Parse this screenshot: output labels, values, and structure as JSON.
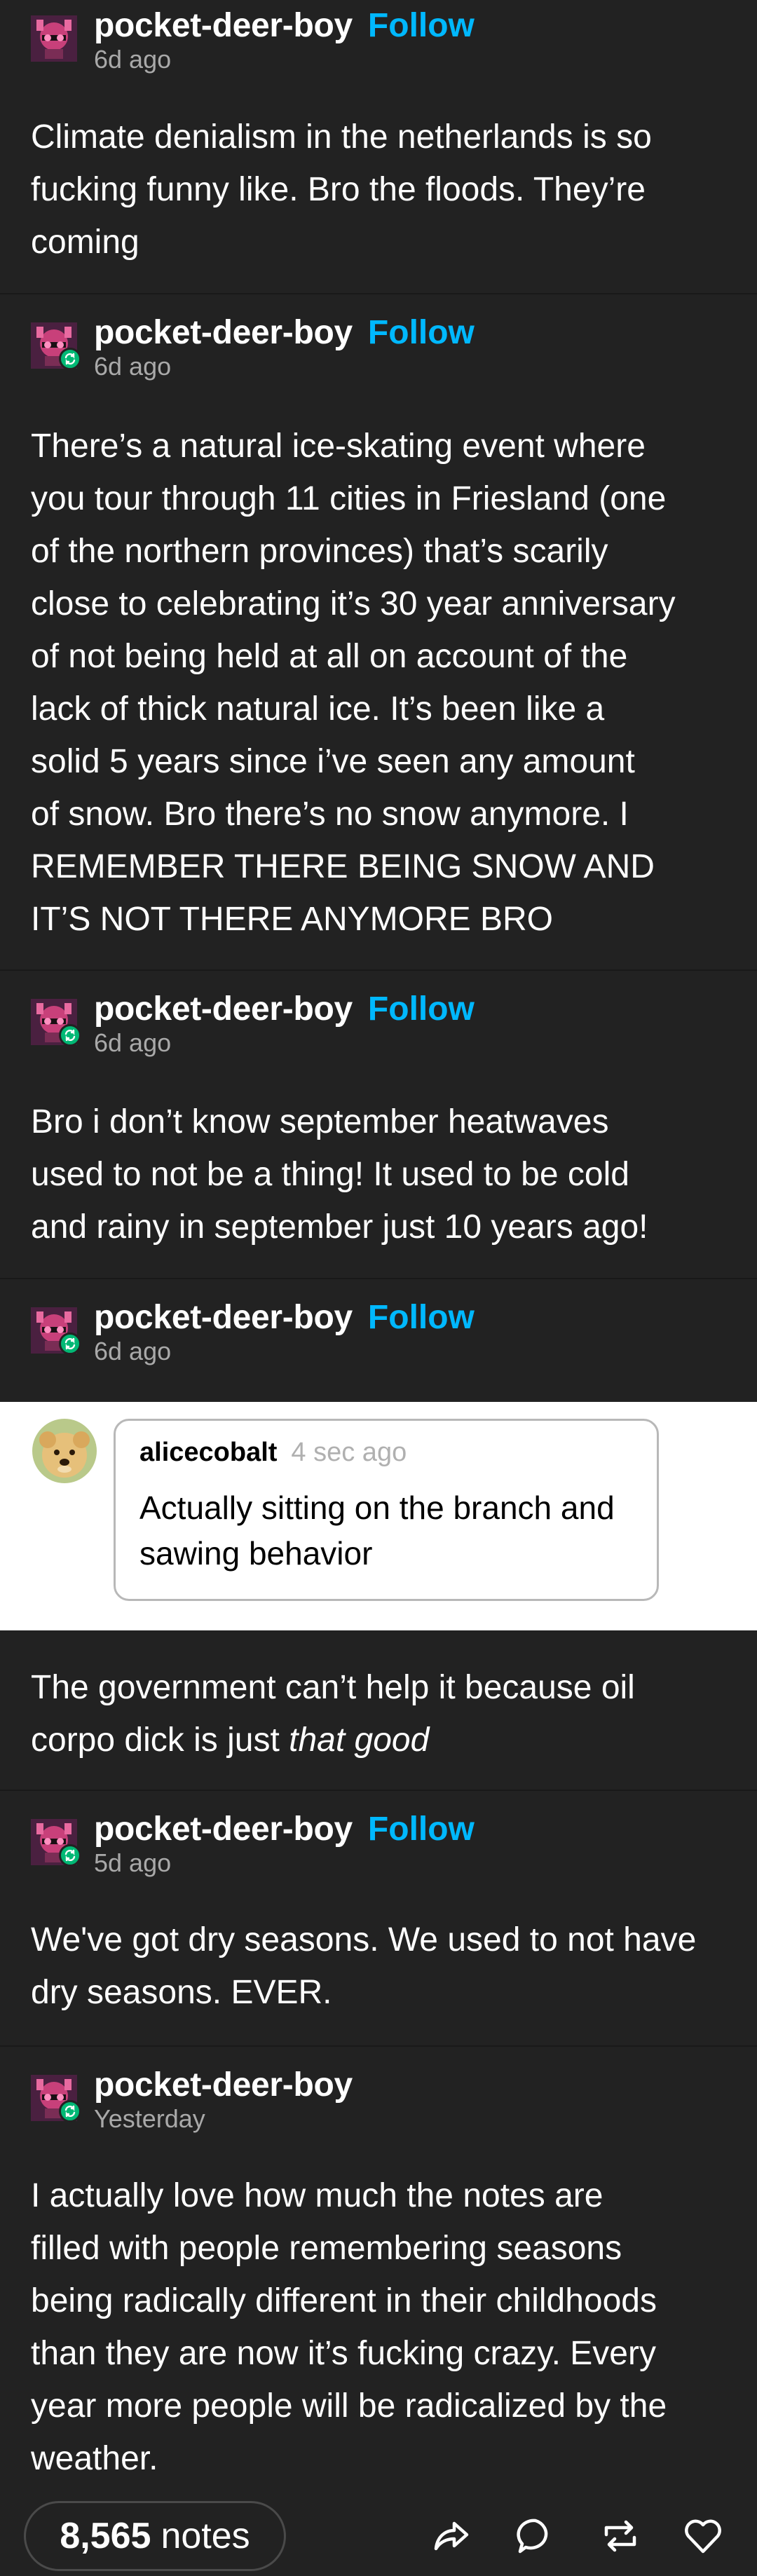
{
  "posts": [
    {
      "username": "pocket-deer-boy",
      "follow": "Follow",
      "time": "6d ago",
      "reblogged": false,
      "lines": [
        "Climate denialism in the netherlands is so",
        "fucking funny like. Bro the floods. They’re",
        "coming"
      ]
    },
    {
      "username": "pocket-deer-boy",
      "follow": "Follow",
      "time": "6d ago",
      "reblogged": true,
      "lines": [
        "There’s a natural ice-skating event where",
        "you tour through 11 cities in Friesland (one",
        "of the northern provinces) that’s scarily",
        "close to celebrating it’s 30 year anniversary",
        "of not being held at all on account of the",
        "lack of thick natural ice. It’s been like a",
        "solid 5 years since i’ve seen any amount",
        "of snow. Bro there’s no snow anymore. I",
        "REMEMBER THERE BEING SNOW AND",
        "IT’S NOT THERE ANYMORE BRO"
      ]
    },
    {
      "username": "pocket-deer-boy",
      "follow": "Follow",
      "time": "6d ago",
      "reblogged": true,
      "lines": [
        "Bro i don’t know september heatwaves",
        "used to not be a thing! It used to be cold",
        "and rainy in september just 10 years ago!"
      ]
    },
    {
      "username": "pocket-deer-boy",
      "follow": "Follow",
      "time": "6d ago",
      "reblogged": true,
      "comment": {
        "username": "alicecobalt",
        "time": "4 sec ago",
        "lines": [
          "Actually sitting on the branch and",
          "sawing behavior"
        ]
      },
      "lines": [
        "The government can’t help it because oil",
        "corpo dick is just "
      ],
      "italic_tail": "that good"
    },
    {
      "username": "pocket-deer-boy",
      "follow": "Follow",
      "time": "5d ago",
      "reblogged": true,
      "lines": [
        "We've got dry seasons. We used to not have",
        "dry seasons. EVER."
      ]
    },
    {
      "username": "pocket-deer-boy",
      "follow": "",
      "time": "Yesterday",
      "reblogged": true,
      "lines": [
        "I actually love how much the notes are",
        "filled with people remembering seasons",
        "being radically different in their childhoods",
        "than they are now it’s fucking crazy. Every",
        "year more people will be radicalized by the",
        "weather."
      ]
    }
  ],
  "footer": {
    "notes_count": "8,565",
    "notes_label": "notes",
    "actions": [
      "share-icon",
      "reply-icon",
      "reblog-icon",
      "like-icon"
    ]
  },
  "colors": {
    "background": "#222222",
    "follow": "#00b8ff",
    "reblog_badge": "#02b875"
  }
}
